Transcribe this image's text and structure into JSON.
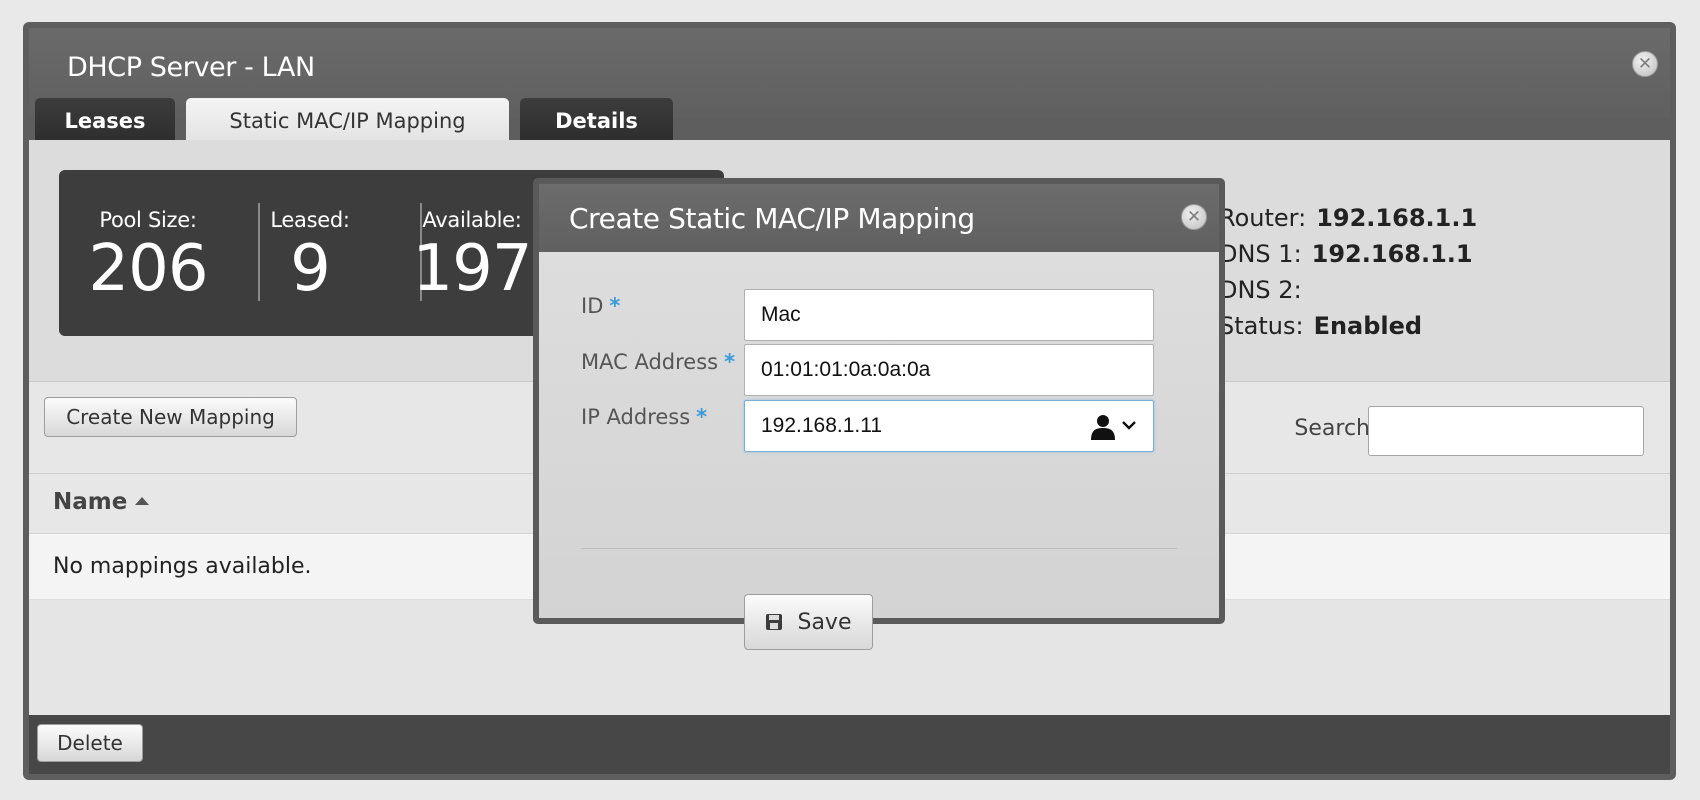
{
  "window": {
    "title": "DHCP Server - LAN",
    "close_glyph": "✕"
  },
  "tabs": [
    {
      "label": "Leases",
      "active": false
    },
    {
      "label": "Static MAC/IP Mapping",
      "active": true
    },
    {
      "label": "Details",
      "active": false
    }
  ],
  "stats": [
    {
      "label": "Pool Size:",
      "value": "206"
    },
    {
      "label": "Leased:",
      "value": "9"
    },
    {
      "label": "Available:",
      "value": "197"
    }
  ],
  "info": [
    {
      "label": "Router:",
      "value": "192.168.1.1"
    },
    {
      "label": "DNS 1:",
      "value": "192.168.1.1"
    },
    {
      "label": "DNS 2:",
      "value": ""
    },
    {
      "label": "Status:",
      "value": "Enabled"
    }
  ],
  "toolbar": {
    "create_label": "Create New Mapping",
    "search_label": "Search",
    "search_value": ""
  },
  "table": {
    "columns": [
      {
        "label": "Name",
        "sort": "ascending"
      }
    ],
    "empty_message": "No mappings available."
  },
  "footer": {
    "delete_label": "Delete"
  },
  "modal": {
    "title": "Create Static MAC/IP Mapping",
    "close_glyph": "✕",
    "required_marker": "*",
    "fields": [
      {
        "label": "ID",
        "value": "Mac"
      },
      {
        "label": "MAC Address",
        "value": "01:01:01:0a:0a:0a"
      },
      {
        "label": "IP Address",
        "value": "192.168.1.11"
      }
    ],
    "save_label": "Save"
  },
  "colors": {
    "accent": "#3a9ad9",
    "titlebar": "#666666",
    "stats_bg": "#3d3d3d",
    "footer_bg": "#474747"
  },
  "icons": [
    "close-icon",
    "sort-ascending-icon",
    "user-icon",
    "chevron-down-icon",
    "save-icon"
  ]
}
